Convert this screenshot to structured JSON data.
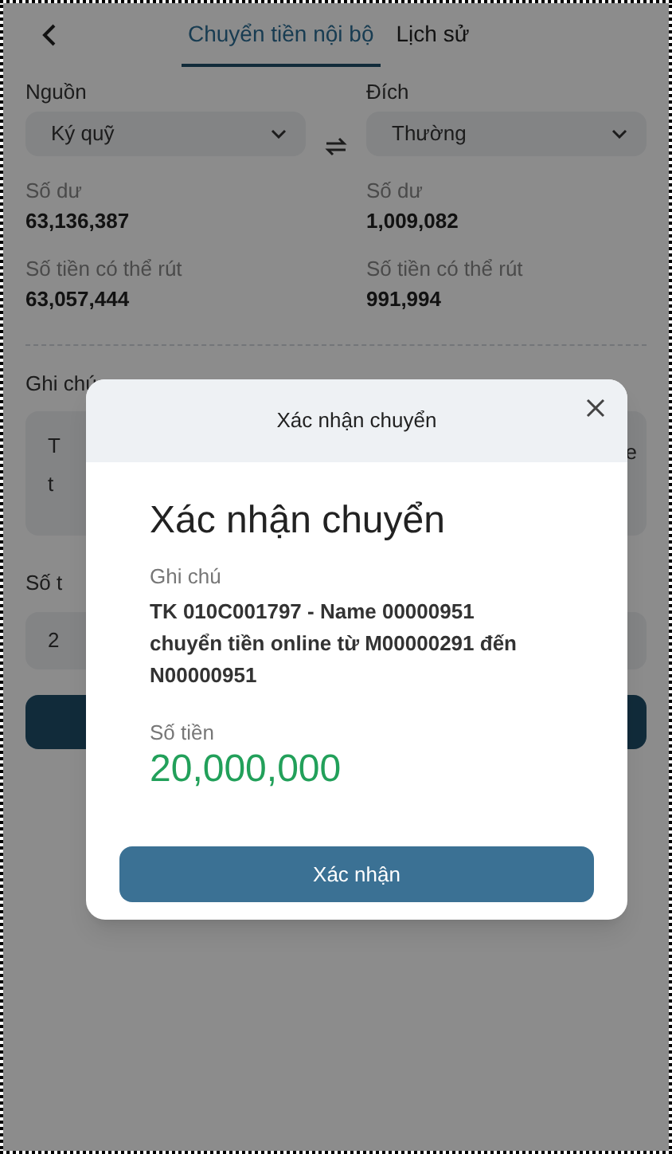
{
  "tabs": [
    {
      "label": "Chuyển tiền nội bộ",
      "selected": true
    },
    {
      "label": "Lịch sử",
      "selected": false
    }
  ],
  "accounts": [
    {
      "label": "Nguồn",
      "value": "Ký quỹ",
      "balance_label": "Số dư",
      "balance": "63,136,387",
      "withdrawable_label": "Số tiền có thể rút",
      "withdrawable": "63,057,444"
    },
    {
      "label": "Đích",
      "value": "Thường",
      "balance_label": "Số dư",
      "balance": "1,009,082",
      "withdrawable_label": "Số tiền có thể rút",
      "withdrawable": "991,994"
    }
  ],
  "note": {
    "label": "Ghi chú",
    "visible_left": [
      "T",
      "t"
    ],
    "visible_right": "e"
  },
  "amount": {
    "label": "Số t",
    "value": "2"
  },
  "dialog": {
    "title": "Xác nhận chuyển",
    "heading": "Xác nhận chuyển",
    "note_label": "Ghi chú",
    "note": "TK 010C001797 - Name 00000951 chuyển tiền online từ M00000291 đến N00000951",
    "amount_label": "Số tiền",
    "amount": "20,000,000",
    "confirm_button": "Xác nhận"
  }
}
